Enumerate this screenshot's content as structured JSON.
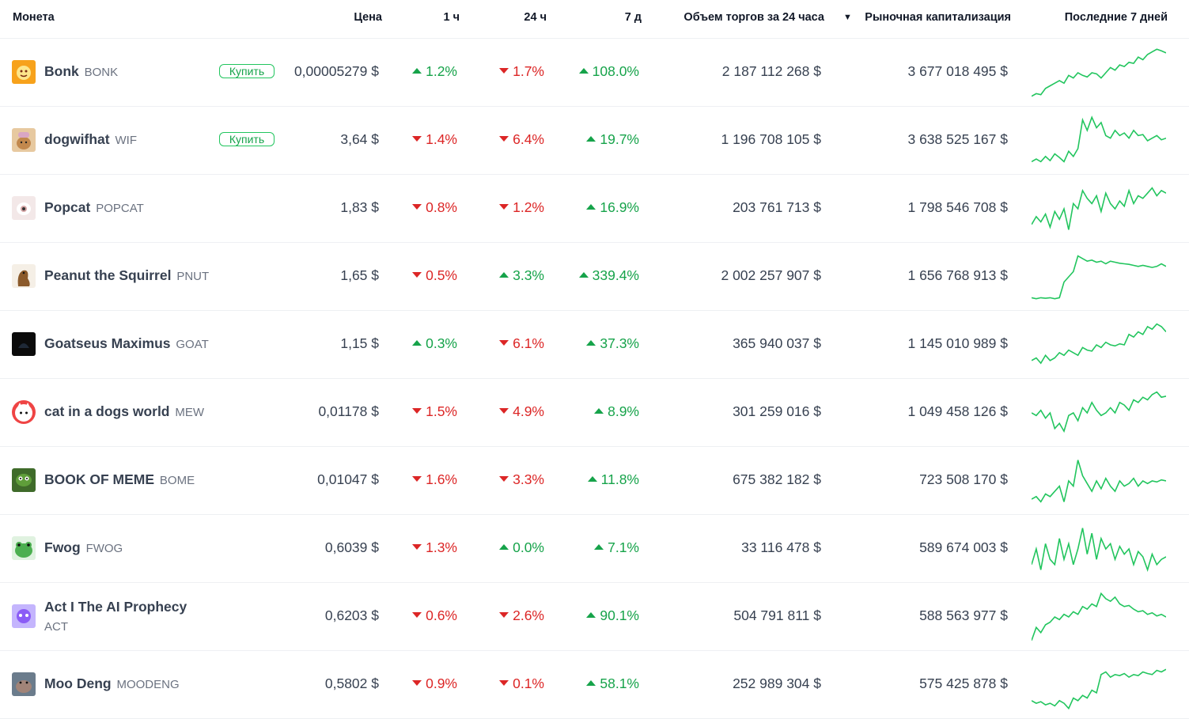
{
  "header": {
    "coin": "Монета",
    "price": "Цена",
    "h1": "1 ч",
    "h24": "24 ч",
    "d7": "7 д",
    "volume": "Объем торгов за 24 часа",
    "mcap": "Рыночная капитализация",
    "sort_indicator": "▼",
    "last7": "Последние 7 дней"
  },
  "buy_label": "Купить",
  "up_color": "#16a34a",
  "down_color": "#dc2626",
  "rows": [
    {
      "name": "Bonk",
      "symbol": "BONK",
      "buy": true,
      "price": "0,00005279 $",
      "h1": "1.2%",
      "h1_dir": "up",
      "h24": "1.7%",
      "h24_dir": "down",
      "d7": "108.0%",
      "d7_dir": "up",
      "volume": "2 187 112 268 $",
      "mcap": "3 677 018 495 $",
      "icon": "bonk-dog-icon",
      "spark": [
        0.05,
        0.1,
        0.08,
        0.2,
        0.25,
        0.3,
        0.35,
        0.3,
        0.45,
        0.4,
        0.5,
        0.45,
        0.42,
        0.5,
        0.48,
        0.4,
        0.5,
        0.6,
        0.55,
        0.65,
        0.62,
        0.7,
        0.68,
        0.8,
        0.75,
        0.85,
        0.9,
        0.95,
        0.92,
        0.88
      ]
    },
    {
      "name": "dogwifhat",
      "symbol": "WIF",
      "buy": true,
      "price": "3,64 $",
      "h1": "1.4%",
      "h1_dir": "down",
      "h24": "6.4%",
      "h24_dir": "down",
      "d7": "19.7%",
      "d7_dir": "up",
      "volume": "1 196 708 105 $",
      "mcap": "3 638 525 167 $",
      "icon": "dog-hat-icon",
      "spark": [
        0.1,
        0.15,
        0.1,
        0.2,
        0.12,
        0.25,
        0.18,
        0.1,
        0.3,
        0.2,
        0.35,
        0.9,
        0.7,
        0.95,
        0.75,
        0.85,
        0.6,
        0.55,
        0.7,
        0.6,
        0.65,
        0.55,
        0.7,
        0.6,
        0.62,
        0.5,
        0.55,
        0.6,
        0.52,
        0.55
      ]
    },
    {
      "name": "Popcat",
      "symbol": "POPCAT",
      "buy": false,
      "price": "1,83 $",
      "h1": "0.8%",
      "h1_dir": "down",
      "h24": "1.2%",
      "h24_dir": "down",
      "d7": "16.9%",
      "d7_dir": "up",
      "volume": "203 761 713 $",
      "mcap": "1 798 546 708 $",
      "icon": "popcat-icon",
      "spark": [
        0.2,
        0.35,
        0.25,
        0.4,
        0.15,
        0.45,
        0.3,
        0.5,
        0.1,
        0.6,
        0.5,
        0.85,
        0.7,
        0.6,
        0.75,
        0.45,
        0.8,
        0.6,
        0.5,
        0.65,
        0.55,
        0.85,
        0.6,
        0.75,
        0.7,
        0.8,
        0.9,
        0.75,
        0.85,
        0.8
      ]
    },
    {
      "name": "Peanut the Squirrel",
      "symbol": "PNUT",
      "buy": false,
      "price": "1,65 $",
      "h1": "0.5%",
      "h1_dir": "down",
      "h24": "3.3%",
      "h24_dir": "up",
      "d7": "339.4%",
      "d7_dir": "up",
      "volume": "2 002 257 907 $",
      "mcap": "1 656 768 913 $",
      "icon": "squirrel-icon",
      "spark": [
        0.1,
        0.08,
        0.1,
        0.09,
        0.1,
        0.08,
        0.1,
        0.4,
        0.5,
        0.6,
        0.9,
        0.85,
        0.8,
        0.82,
        0.78,
        0.8,
        0.75,
        0.8,
        0.78,
        0.76,
        0.75,
        0.74,
        0.72,
        0.7,
        0.72,
        0.7,
        0.68,
        0.7,
        0.75,
        0.7
      ]
    },
    {
      "name": "Goatseus Maximus",
      "symbol": "GOAT",
      "buy": false,
      "price": "1,15 $",
      "h1": "0.3%",
      "h1_dir": "up",
      "h24": "6.1%",
      "h24_dir": "down",
      "d7": "37.3%",
      "d7_dir": "up",
      "volume": "365 940 037 $",
      "mcap": "1 145 010 989 $",
      "icon": "goat-icon",
      "spark": [
        0.2,
        0.25,
        0.15,
        0.3,
        0.2,
        0.25,
        0.35,
        0.3,
        0.4,
        0.35,
        0.3,
        0.45,
        0.4,
        0.38,
        0.5,
        0.45,
        0.55,
        0.5,
        0.48,
        0.52,
        0.5,
        0.7,
        0.65,
        0.75,
        0.7,
        0.85,
        0.8,
        0.9,
        0.85,
        0.75
      ]
    },
    {
      "name": "cat in a dogs world",
      "symbol": "MEW",
      "buy": false,
      "price": "0,01178 $",
      "h1": "1.5%",
      "h1_dir": "down",
      "h24": "4.9%",
      "h24_dir": "down",
      "d7": "8.9%",
      "d7_dir": "up",
      "volume": "301 259 016 $",
      "mcap": "1 049 458 126 $",
      "icon": "mew-cat-icon",
      "spark": [
        0.5,
        0.45,
        0.55,
        0.4,
        0.5,
        0.2,
        0.3,
        0.15,
        0.45,
        0.5,
        0.35,
        0.6,
        0.5,
        0.7,
        0.55,
        0.45,
        0.5,
        0.6,
        0.5,
        0.7,
        0.65,
        0.55,
        0.75,
        0.7,
        0.8,
        0.75,
        0.85,
        0.9,
        0.8,
        0.82
      ]
    },
    {
      "name": "BOOK OF MEME",
      "symbol": "BOME",
      "buy": false,
      "price": "0,01047 $",
      "h1": "1.6%",
      "h1_dir": "down",
      "h24": "3.3%",
      "h24_dir": "down",
      "d7": "11.8%",
      "d7_dir": "up",
      "volume": "675 382 182 $",
      "mcap": "723 508 170 $",
      "icon": "pepe-book-icon",
      "spark": [
        0.15,
        0.2,
        0.1,
        0.25,
        0.2,
        0.3,
        0.4,
        0.1,
        0.5,
        0.4,
        0.9,
        0.6,
        0.45,
        0.3,
        0.5,
        0.35,
        0.55,
        0.4,
        0.3,
        0.5,
        0.4,
        0.45,
        0.55,
        0.4,
        0.5,
        0.45,
        0.5,
        0.48,
        0.52,
        0.5
      ]
    },
    {
      "name": "Fwog",
      "symbol": "FWOG",
      "buy": false,
      "price": "0,6039 $",
      "h1": "1.3%",
      "h1_dir": "down",
      "h24": "0.0%",
      "h24_dir": "up",
      "d7": "7.1%",
      "d7_dir": "up",
      "volume": "33 116 478 $",
      "mcap": "589 674 003 $",
      "icon": "frog-icon",
      "spark": [
        0.2,
        0.5,
        0.1,
        0.6,
        0.3,
        0.2,
        0.7,
        0.3,
        0.6,
        0.2,
        0.5,
        0.9,
        0.4,
        0.8,
        0.3,
        0.7,
        0.5,
        0.6,
        0.3,
        0.55,
        0.4,
        0.5,
        0.2,
        0.45,
        0.35,
        0.1,
        0.4,
        0.2,
        0.3,
        0.35
      ]
    },
    {
      "name": "Act I The AI Prophecy",
      "symbol": "ACT",
      "buy": false,
      "price": "0,6203 $",
      "h1": "0.6%",
      "h1_dir": "down",
      "h24": "2.6%",
      "h24_dir": "down",
      "d7": "90.1%",
      "d7_dir": "up",
      "volume": "504 791 811 $",
      "mcap": "588 563 977 $",
      "icon": "act-ai-icon",
      "spark": [
        0.05,
        0.3,
        0.2,
        0.35,
        0.4,
        0.5,
        0.45,
        0.55,
        0.5,
        0.6,
        0.55,
        0.7,
        0.65,
        0.75,
        0.7,
        0.95,
        0.85,
        0.8,
        0.88,
        0.75,
        0.7,
        0.72,
        0.65,
        0.6,
        0.62,
        0.55,
        0.58,
        0.52,
        0.55,
        0.5
      ]
    },
    {
      "name": "Moo Deng",
      "symbol": "MOODENG",
      "buy": false,
      "price": "0,5802 $",
      "h1": "0.9%",
      "h1_dir": "down",
      "h24": "0.1%",
      "h24_dir": "down",
      "d7": "58.1%",
      "d7_dir": "up",
      "volume": "252 989 304 $",
      "mcap": "575 425 878 $",
      "icon": "hippo-icon",
      "spark": [
        0.2,
        0.15,
        0.18,
        0.12,
        0.15,
        0.1,
        0.2,
        0.15,
        0.05,
        0.25,
        0.2,
        0.3,
        0.25,
        0.4,
        0.35,
        0.7,
        0.75,
        0.65,
        0.7,
        0.68,
        0.72,
        0.65,
        0.7,
        0.68,
        0.75,
        0.72,
        0.7,
        0.78,
        0.75,
        0.8
      ]
    }
  ]
}
